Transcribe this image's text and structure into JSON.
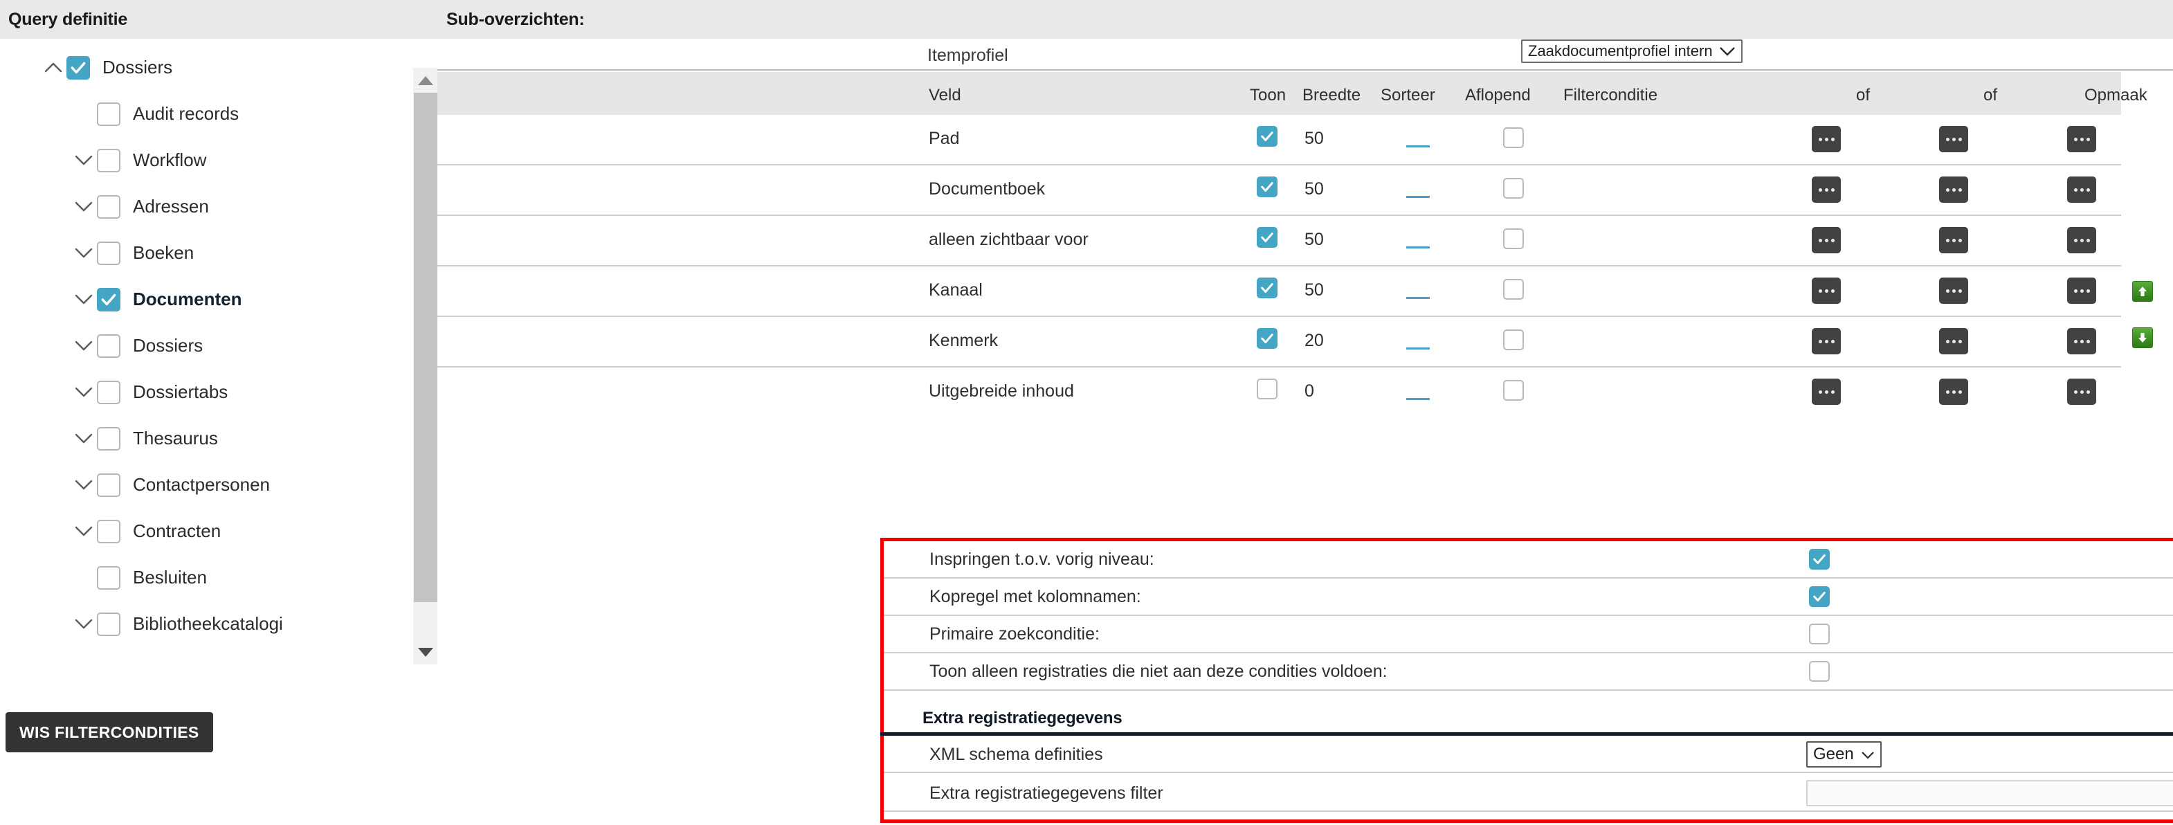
{
  "sidebar": {
    "title": "Query definitie",
    "clear_button": "WIS FILTERCONDITIES",
    "items": [
      {
        "label": "Dossiers",
        "indent": 0,
        "chevron": "up",
        "checked": true,
        "bold": false
      },
      {
        "label": "Audit records",
        "indent": 1,
        "chevron": "none",
        "checked": false,
        "bold": false
      },
      {
        "label": "Workflow",
        "indent": 1,
        "chevron": "down",
        "checked": false,
        "bold": false
      },
      {
        "label": "Adressen",
        "indent": 1,
        "chevron": "down",
        "checked": false,
        "bold": false
      },
      {
        "label": "Boeken",
        "indent": 1,
        "chevron": "down",
        "checked": false,
        "bold": false
      },
      {
        "label": "Documenten",
        "indent": 1,
        "chevron": "down",
        "checked": true,
        "bold": true
      },
      {
        "label": "Dossiers",
        "indent": 1,
        "chevron": "down",
        "checked": false,
        "bold": false
      },
      {
        "label": "Dossiertabs",
        "indent": 1,
        "chevron": "down",
        "checked": false,
        "bold": false
      },
      {
        "label": "Thesaurus",
        "indent": 1,
        "chevron": "down",
        "checked": false,
        "bold": false
      },
      {
        "label": "Contactpersonen",
        "indent": 1,
        "chevron": "down",
        "checked": false,
        "bold": false
      },
      {
        "label": "Contracten",
        "indent": 1,
        "chevron": "down",
        "checked": false,
        "bold": false
      },
      {
        "label": "Besluiten",
        "indent": 1,
        "chevron": "none",
        "checked": false,
        "bold": false
      },
      {
        "label": "Bibliotheekcatalogi",
        "indent": 1,
        "chevron": "down",
        "checked": false,
        "bold": false
      }
    ]
  },
  "main": {
    "title": "Sub-overzichten:",
    "itemprofiel": {
      "label": "Itemprofiel",
      "selected": "Zaakdocumentprofiel intern"
    },
    "columns": {
      "veld": "Veld",
      "toon": "Toon",
      "breedte": "Breedte",
      "sorteer": "Sorteer",
      "aflopend": "Aflopend",
      "filterconditie": "Filterconditie",
      "of1": "of",
      "of2": "of",
      "opmaak": "Opmaak"
    },
    "rows": [
      {
        "veld": "Pad",
        "toon": true,
        "breedte": "50",
        "aflopend": false
      },
      {
        "veld": "Documentboek",
        "toon": true,
        "breedte": "50",
        "aflopend": false
      },
      {
        "veld": "alleen zichtbaar voor",
        "toon": true,
        "breedte": "50",
        "aflopend": false
      },
      {
        "veld": "Kanaal",
        "toon": true,
        "breedte": "50",
        "aflopend": false
      },
      {
        "veld": "Kenmerk",
        "toon": true,
        "breedte": "20",
        "aflopend": false
      },
      {
        "veld": "Uitgebreide inhoud",
        "toon": false,
        "breedte": "0",
        "aflopend": false
      }
    ],
    "options": [
      {
        "label": "Inspringen t.o.v. vorig niveau:",
        "checked": true
      },
      {
        "label": "Kopregel met kolomnamen:",
        "checked": true
      },
      {
        "label": "Primaire zoekconditie:",
        "checked": false
      },
      {
        "label": "Toon alleen registraties die niet aan deze condities voldoen:",
        "checked": false
      }
    ],
    "extra_section": {
      "title": "Extra registratiegegevens",
      "xml_label": "XML schema definities",
      "xml_value": "Geen",
      "filter_label": "Extra registratiegegevens filter",
      "filter_value": ""
    }
  },
  "colors": {
    "accent": "#45a5c4",
    "highlight_border": "#f40000",
    "dark_button": "#333333",
    "header_bg": "#e9e9e9",
    "move_green": "#3f8f22"
  }
}
